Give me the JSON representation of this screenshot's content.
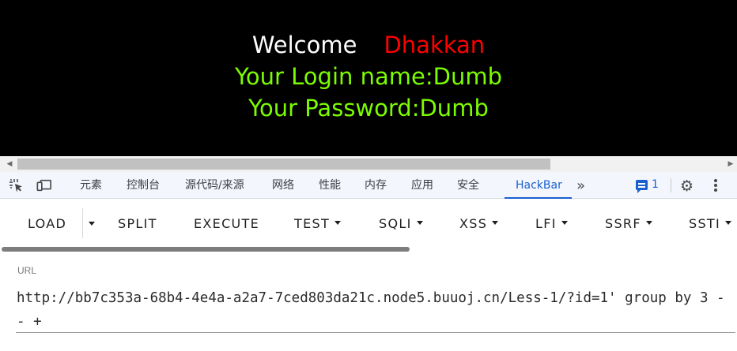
{
  "page": {
    "welcome_text": "Welcome",
    "username": "Dhakkan",
    "login_line": "Your Login name:Dumb",
    "password_line": "Your Password:Dumb"
  },
  "devtools": {
    "tabs": [
      {
        "label": "元素"
      },
      {
        "label": "控制台"
      },
      {
        "label": "源代码/来源"
      },
      {
        "label": "网络"
      },
      {
        "label": "性能"
      },
      {
        "label": "内存"
      },
      {
        "label": "应用"
      },
      {
        "label": "安全"
      },
      {
        "label": "HackBar"
      }
    ],
    "active_tab": "HackBar",
    "overflow_glyph": "»",
    "messages_count": "1",
    "settings_glyph": "⚙"
  },
  "hackbar": {
    "buttons": [
      {
        "label": "LOAD"
      },
      {
        "label": "SPLIT"
      },
      {
        "label": "EXECUTE"
      },
      {
        "label": "TEST"
      },
      {
        "label": "SQLI"
      },
      {
        "label": "XSS"
      },
      {
        "label": "LFI"
      },
      {
        "label": "SSRF"
      },
      {
        "label": "SSTI"
      }
    ],
    "url_label": "URL",
    "url_value": "http://bb7c353a-68b4-4e4a-a2a7-7ced803da21c.node5.buuoj.cn/Less-1/?id=1' group by 3 -- +"
  },
  "colors": {
    "page_background": "#000000",
    "welcome": "#ffffff",
    "username": "#ff0000",
    "credentials": "#7cfc00",
    "devtools_active": "#1a5fd0"
  },
  "icons": {
    "scroll_left": "triangle-left-icon",
    "scroll_right": "triangle-right-icon",
    "inspect": "inspect-element-icon",
    "device": "device-toolbar-icon",
    "more_tabs": "chevron-double-right-icon",
    "messages": "message-icon",
    "settings": "gear-icon",
    "menu": "kebab-menu-icon"
  }
}
